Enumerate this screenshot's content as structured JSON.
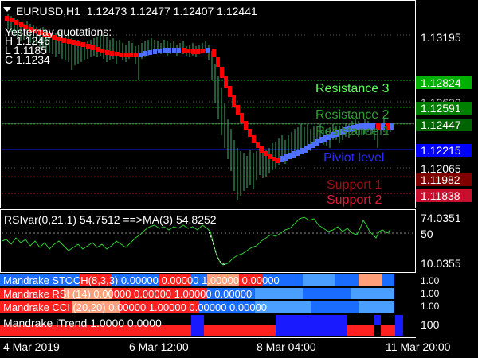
{
  "header": {
    "symbol": "EURUSD,H1",
    "ohlc": "1.12473 1.12477 1.12407 1.12441",
    "yesterday_title": "Yesterday quotations:",
    "yesterday_h": "H 1.1246",
    "yesterday_l": "L 1.1185",
    "yesterday_c": "C 1.1234"
  },
  "price_axis": {
    "ticks": [
      "1.13195",
      "1.12630",
      "1.12065"
    ],
    "levels": [
      {
        "name": "Resistance 3",
        "value": "1.12824",
        "line_color": "#00c000",
        "text_color": "#5cff5c",
        "tag_bg": "#00b000"
      },
      {
        "name": "Resistance 2",
        "value": "1.12591",
        "line_color": "#00a000",
        "text_color": "#2fa02f",
        "tag_bg": "#008000"
      },
      {
        "name": "Resistance 1",
        "value": "1.12447",
        "line_color": "#008000",
        "text_color": "#2c8a2c",
        "tag_bg": "#006400"
      },
      {
        "name": "Piviot level",
        "value": "1.12215",
        "line_color": "#1a1aff",
        "text_color": "#2a2aff",
        "tag_bg": "#0000ff"
      },
      {
        "name": "Support 1",
        "value": "1.11982",
        "line_color": "#8b0000",
        "text_color": "#a01010",
        "tag_bg": "#800000"
      },
      {
        "name": "Support 2",
        "value": "1.11838",
        "line_color": "#cc1030",
        "text_color": "#e01a3a",
        "tag_bg": "#c8102e"
      }
    ]
  },
  "rsi": {
    "label": "RSIvar(0,21,1) 54.7512 ==>MA(3) 54.8252",
    "ticks": [
      "74.0351",
      "50",
      "10.0355"
    ]
  },
  "strips": [
    {
      "label": "Mandrake STOCH(8,3,3) 0.00000 0.00000 1.00000 0.00000",
      "scale": "1.00"
    },
    {
      "label": "Mandrake RSI (14) 0.00000 0.00000 1.00000 0.00000",
      "scale": "1.00"
    },
    {
      "label": "Mandrake CCI (20,20) 0.00000 1.00000 0.00000 0.00000",
      "scale": "1.00"
    },
    {
      "label": "Mandrake iTrend 1.0000 0.0000",
      "scale": "100"
    }
  ],
  "time_axis": [
    "4 Mar 2019",
    "6 Mar 12:00",
    "8 Mar 04:00",
    "11 Mar 20:00"
  ],
  "colors": {
    "bull": "#ff0000",
    "bear": "#4f6fff",
    "candle": "#3cb371",
    "rsi_line": "#32cd32"
  }
}
